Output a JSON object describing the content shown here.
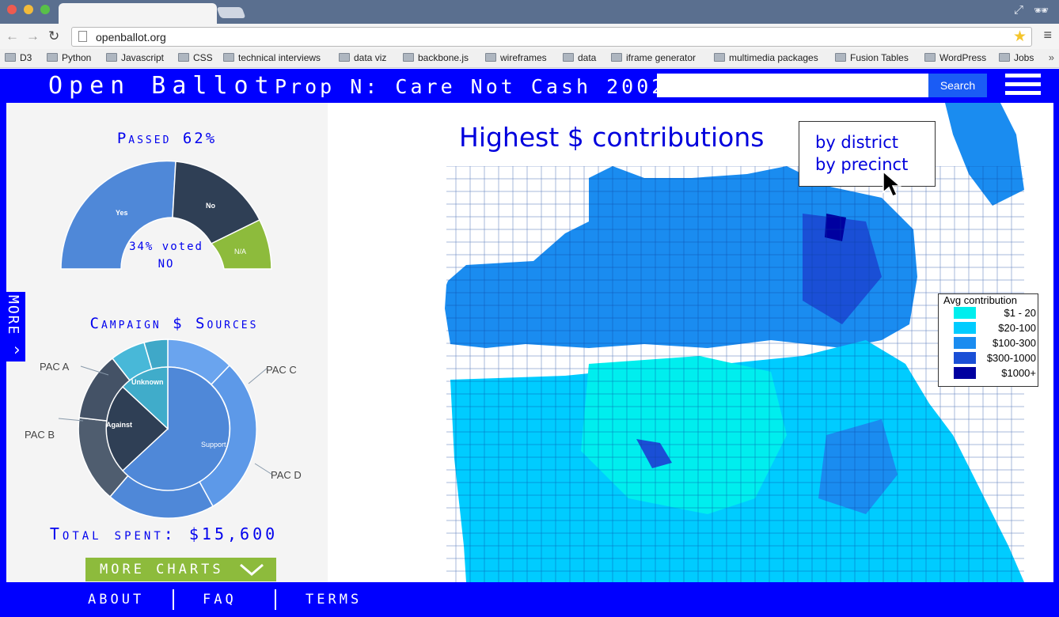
{
  "browser": {
    "url": "openballot.org",
    "bookmarks": [
      "D3",
      "Python",
      "Javascript",
      "CSS",
      "technical interviews",
      "data viz",
      "backbone.js",
      "wireframes",
      "data",
      "iframe generator",
      "multimedia packages",
      "Fusion Tables",
      "WordPress",
      "Jobs"
    ],
    "bookmarks_more": "»"
  },
  "header": {
    "brand": "Open Ballot",
    "prop_title": "Prop N: Care Not Cash 2002",
    "search_placeholder": "",
    "search_button": "Search"
  },
  "sidebar": {
    "passed_title": "Passed 62%",
    "vote_chart": {
      "type": "pie",
      "labels": [
        "Yes",
        "No",
        "N/A"
      ],
      "center_text": "34% voted NO"
    },
    "voted_line1": "34% voted",
    "voted_line2": "NO",
    "sources_title": "Campaign $ Sources",
    "sources_chart": {
      "type": "pie",
      "inner_labels": [
        "Support",
        "Against",
        "Unknown"
      ],
      "outer_labels": [
        "PAC A",
        "PAC B",
        "PAC C",
        "PAC D"
      ]
    },
    "total_spent": "Total spent: $15,600",
    "more_charts_button": "more charts",
    "more_tab": "MORE"
  },
  "map": {
    "title": "Highest $ contributions",
    "dropdown_options": [
      "by district",
      "by precinct"
    ],
    "legend": {
      "title": "Avg contribution",
      "items": [
        {
          "label": "$1 - 20",
          "color": "#00eeee"
        },
        {
          "label": "$20-100",
          "color": "#00ccff"
        },
        {
          "label": "$100-300",
          "color": "#1a8cf0"
        },
        {
          "label": "$300-1000",
          "color": "#1a4fd6"
        },
        {
          "label": "$1000+",
          "color": "#0000a0"
        }
      ]
    }
  },
  "footer": {
    "links": [
      "about",
      "faq",
      "terms"
    ]
  },
  "colors": {
    "brand_blue": "#0000ff",
    "yes": "#4f88d8",
    "no": "#2f3f55",
    "na": "#8dbb3c",
    "more_button": "#8dbb3c"
  }
}
